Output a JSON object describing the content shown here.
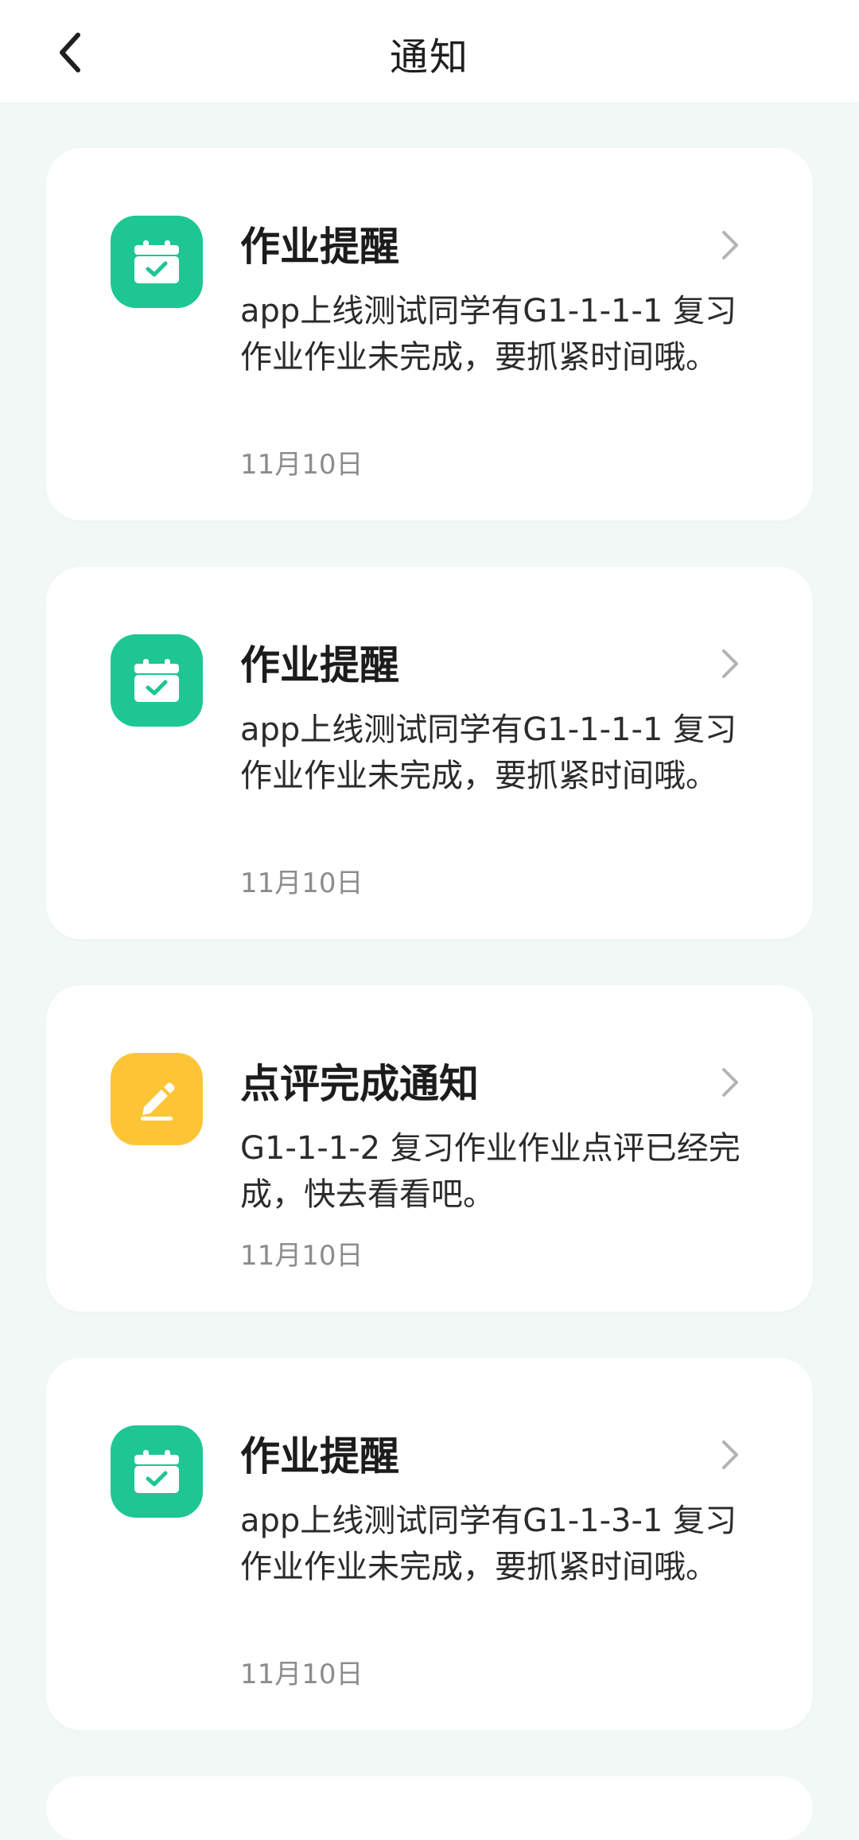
{
  "header": {
    "title": "通知",
    "back_icon": "chevron-left-icon"
  },
  "colors": {
    "background": "#f1f8f6",
    "card": "#ffffff",
    "homework_icon_bg": "#1ec694",
    "review_icon_bg": "#fdc536",
    "date_text": "#8c8c8c"
  },
  "notifications": [
    {
      "type": "homework",
      "icon": "calendar-check-icon",
      "title": "作业提醒",
      "message": "app上线测试同学有G1-1-1-1 复习作业作业未完成，要抓紧时间哦。",
      "date": "11月10日"
    },
    {
      "type": "homework",
      "icon": "calendar-check-icon",
      "title": "作业提醒",
      "message": "app上线测试同学有G1-1-1-1 复习作业作业未完成，要抓紧时间哦。",
      "date": "11月10日"
    },
    {
      "type": "review",
      "icon": "pencil-icon",
      "title": "点评完成通知",
      "message": "G1-1-1-2 复习作业作业点评已经完成，快去看看吧。",
      "date": "11月10日"
    },
    {
      "type": "homework",
      "icon": "calendar-check-icon",
      "title": "作业提醒",
      "message": "app上线测试同学有G1-1-3-1 复习作业作业未完成，要抓紧时间哦。",
      "date": "11月10日"
    }
  ]
}
